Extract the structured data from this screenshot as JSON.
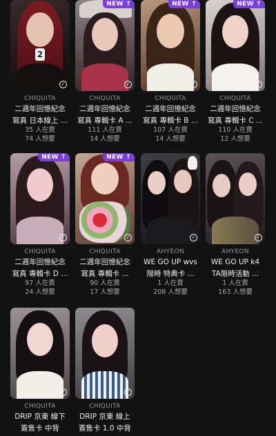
{
  "cards": [
    {
      "brand": "CHIQUITA",
      "title1": "二週年回憶紀念",
      "title2": "寫真 日本線上 ...",
      "selling": "35 人在賣",
      "wanted": "74 人想要",
      "is_new": false,
      "new_label": ""
    },
    {
      "brand": "CHIQUITA",
      "title1": "二週年回憶紀念",
      "title2": "寫真 專輯卡 A ...",
      "selling": "111 人在賣",
      "wanted": "14 人想要",
      "is_new": true,
      "new_label": "NEW ↑"
    },
    {
      "brand": "CHIQUITA",
      "title1": "二週年回憶紀念",
      "title2": "寫真 專輯卡 B ...",
      "selling": "107 人在賣",
      "wanted": "14 人想要",
      "is_new": true,
      "new_label": "NEW ↑"
    },
    {
      "brand": "CHIQUITA",
      "title1": "二週年回憶紀念",
      "title2": "寫真 專輯卡 C ...",
      "selling": "110 人在賣",
      "wanted": "12 人想要",
      "is_new": true,
      "new_label": "NEW ↑"
    },
    {
      "brand": "CHIQUITA",
      "title1": "二週年回憶紀念",
      "title2": "寫真 專輯卡 D ...",
      "selling": "97 人在賣",
      "wanted": "24 人想要",
      "is_new": true,
      "new_label": "NEW ↑"
    },
    {
      "brand": "CHIQUITA",
      "title1": "二週年回憶紀念",
      "title2": "寫真 專輯卡 ...",
      "selling": "90 人在賣",
      "wanted": "17 人想要",
      "is_new": true,
      "new_label": "NEW ↑"
    },
    {
      "brand": "AHYEON",
      "title1": "WE GO UP wvs",
      "title2": "限時 特典卡 ...",
      "selling": "1 人在賣",
      "wanted": "208 人想要",
      "is_new": false,
      "new_label": ""
    },
    {
      "brand": "AHYEON",
      "title1": "WE GO UP k4",
      "title2": "TA限時活動 ...",
      "selling": "1 人在賣",
      "wanted": "163 人想要",
      "is_new": false,
      "new_label": ""
    },
    {
      "brand": "CHIQUITA",
      "title1": "DRIP 京東 線下",
      "title2": "簽售卡 中背",
      "selling": "",
      "wanted": "",
      "is_new": false,
      "new_label": ""
    },
    {
      "brand": "CHIQUITA",
      "title1": "DRIP 京東 線上",
      "title2": "簽售卡 1.0 中背",
      "selling": "",
      "wanted": "",
      "is_new": false,
      "new_label": ""
    }
  ],
  "check_icon_glyph": "✓",
  "colors": {
    "background": "#121212",
    "new_badge": "#7b3fd6",
    "brand_text": "#9a9a9a"
  }
}
